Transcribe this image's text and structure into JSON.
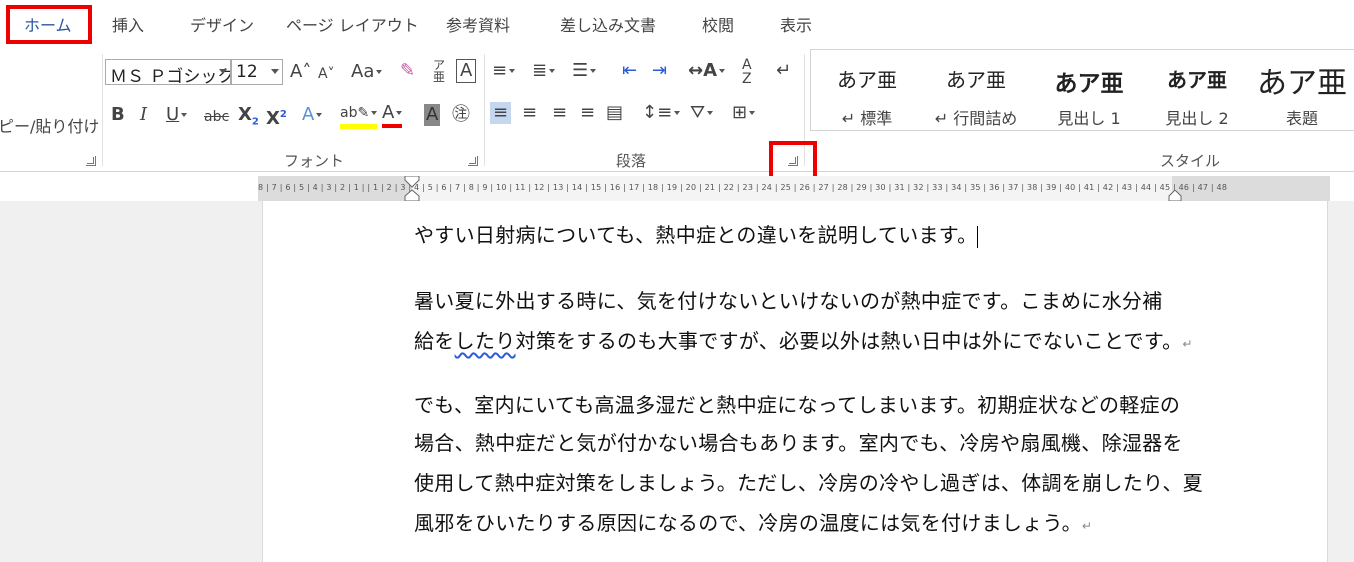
{
  "tabs": [
    {
      "label": "ホーム"
    },
    {
      "label": "挿入"
    },
    {
      "label": "デザイン"
    },
    {
      "label": "ページ レイアウト"
    },
    {
      "label": "参考資料"
    },
    {
      "label": "差し込み文書"
    },
    {
      "label": "校閲"
    },
    {
      "label": "表示"
    }
  ],
  "clipboard": {
    "paste_label": "ピー/貼り付け"
  },
  "font": {
    "name": "ＭＳ Ｐゴシック",
    "size": "12",
    "group_label": "フォント"
  },
  "paragraph": {
    "group_label": "段落"
  },
  "styles": {
    "group_label": "スタイル",
    "items": [
      {
        "sample": "あア亜",
        "name": "↵ 標準"
      },
      {
        "sample": "あア亜",
        "name": "↵ 行間詰め"
      },
      {
        "sample": "あア亜",
        "name": "見出し 1"
      },
      {
        "sample": "あア亜",
        "name": "見出し 2"
      },
      {
        "sample": "あア亜",
        "name": "表題"
      }
    ]
  },
  "ruler": {
    "text": "8 | 7 | 6 | 5 | 4 | 3 | 2 | 1 |   | 1 | 2 | 3 | 4 | 5 | 6 | 7 | 8 | 9 | 10 | 11 | 12 | 13 | 14 | 15 | 16 | 17 | 18 | 19 | 20 | 21 | 22 | 23 | 24 | 25 | 26 | 27 | 28 | 29 | 30 | 31 | 32 | 33 | 34 | 35 | 36 | 37 | 38 | 39 | 40 | 41 | 42 | 43 | 44 | 45 | 46 | 47 | 48"
  },
  "document": {
    "line1": "やすい日射病についても、熱中症との違いを説明しています。",
    "line2": " 暑い夏に外出する時に、気を付けないといけないのが熱中症です。こまめに水分補",
    "line3a": "給を",
    "line3b": "したり",
    "line3c": "対策をするのも大事ですが、必要以外は熱い日中は外にでないことです。",
    "line4": "でも、室内にいても高温多湿だと熱中症になってしまいます。初期症状などの軽症の",
    "line5": "場合、熱中症だと気が付かない場合もあります。室内でも、冷房や扇風機、除湿器を",
    "line6": "使用して熱中症対策をしましょう。ただし、冷房の冷やし過ぎは、体調を崩したり、夏",
    "line7": "風邪をひいたりする原因になるので、冷房の温度には気を付けましょう。",
    "para_mark": "↵"
  },
  "colors": {
    "highlight_box": "#e00000",
    "active_tab": "#2b579a"
  }
}
